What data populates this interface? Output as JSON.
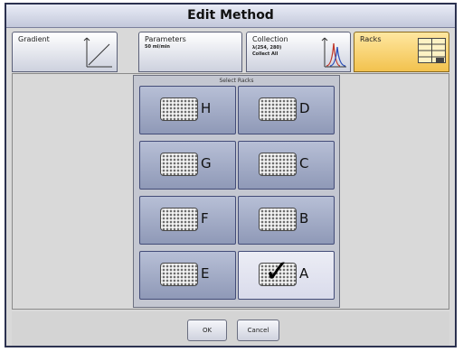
{
  "window": {
    "title": "Edit Method"
  },
  "tabs": [
    {
      "label": "Gradient",
      "sub1": "",
      "sub2": "",
      "icon": "gradient-ramp-icon"
    },
    {
      "label": "Parameters",
      "sub1": "50 ml/min",
      "sub2": "",
      "icon": ""
    },
    {
      "label": "Collection",
      "sub1": "λ(254, 280)",
      "sub2": "Collect All",
      "icon": "chromatogram-peaks-icon"
    },
    {
      "label": "Racks",
      "sub1": "",
      "sub2": "",
      "icon": "rack-grid-icon",
      "active": true
    }
  ],
  "select_racks": {
    "title": "Select Racks",
    "racks": [
      {
        "letter": "H",
        "selected": false
      },
      {
        "letter": "D",
        "selected": false
      },
      {
        "letter": "G",
        "selected": false
      },
      {
        "letter": "C",
        "selected": false
      },
      {
        "letter": "F",
        "selected": false
      },
      {
        "letter": "B",
        "selected": false
      },
      {
        "letter": "E",
        "selected": false
      },
      {
        "letter": "A",
        "selected": true
      }
    ],
    "check_glyph": "✓"
  },
  "buttons": {
    "ok": "OK",
    "cancel": "Cancel"
  },
  "colors": {
    "active_tab": "#f2c24e",
    "rack_button": "#9aa3c0",
    "selected_rack": "#e2e3ef",
    "window_border": "#2c3250"
  }
}
